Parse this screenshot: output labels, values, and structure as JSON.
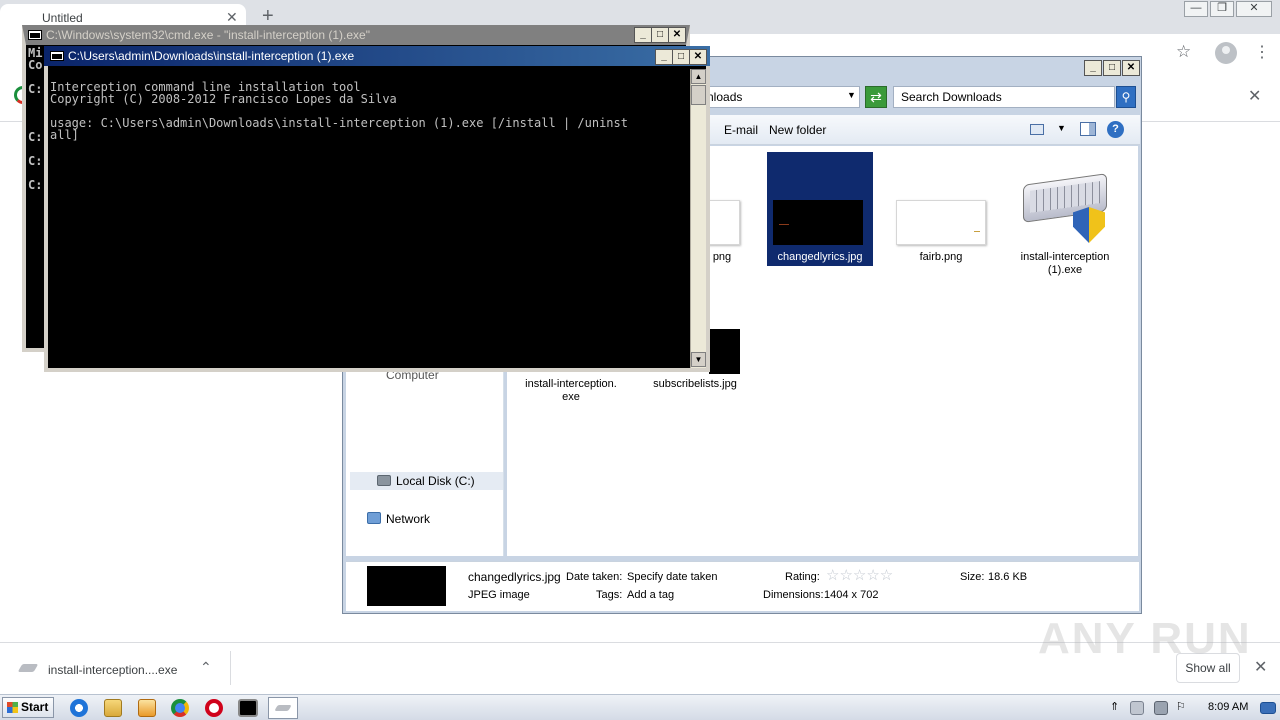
{
  "browser": {
    "tab_title": "Untitled",
    "tab_close": "✕",
    "new_tab": "+",
    "window_controls": [
      "—",
      "❐",
      "✕"
    ],
    "bookmark_icon": "star-icon",
    "menu_glyph": "⋮",
    "infobar_close": "✕"
  },
  "downloads_shelf": {
    "item_name": "install-interception....exe",
    "item_chevron": "⌃",
    "show_all": "Show all",
    "close": "✕"
  },
  "watermark": "ANY RUN",
  "explorer": {
    "address_text": "nloads",
    "search_placeholder": "Search Downloads",
    "commands": [
      "E-mail",
      "New folder"
    ],
    "nav": {
      "computer": "Computer",
      "local_disk": "Local Disk (C:)",
      "network": "Network"
    },
    "files": [
      {
        "name": "png",
        "type": "image-white"
      },
      {
        "name": "changedlyrics.jpg",
        "type": "image-black",
        "selected": true
      },
      {
        "name": "fairb.png",
        "type": "image-white"
      },
      {
        "name": "install-interception (1).exe",
        "type": "exe"
      },
      {
        "name": "install-interception.\nexe",
        "type": "exe"
      },
      {
        "name": "subscribelists.jpg",
        "type": "image-black"
      }
    ],
    "details": {
      "file_name": "changedlyrics.jpg",
      "file_type": "JPEG image",
      "date_taken_label": "Date taken:",
      "date_taken_value": "Specify date taken",
      "tags_label": "Tags:",
      "tags_value": "Add a tag",
      "rating_label": "Rating:",
      "rating_stars": "☆☆☆☆☆",
      "dimensions_label": "Dimensions:",
      "dimensions_value": "1404 x 702",
      "size_label": "Size:",
      "size_value": "18.6 KB"
    }
  },
  "cmd_back": {
    "title": "C:\\Windows\\system32\\cmd.exe - \"install-interception (1).exe\"",
    "left_glyphs": [
      "Mi",
      "Co",
      "C:",
      "C:",
      "C:",
      "C:"
    ]
  },
  "cmd_front": {
    "title": "C:\\Users\\admin\\Downloads\\install-interception (1).exe",
    "line1": "Interception command line installation tool",
    "line2": "Copyright (C) 2008-2012 Francisco Lopes da Silva",
    "line3": "usage: C:\\Users\\admin\\Downloads\\install-interception (1).exe [/install | /uninst",
    "line4": "all]"
  },
  "taskbar": {
    "start": "Start",
    "clock": "8:09 AM",
    "icons": [
      "ie-icon",
      "explorer-icon",
      "media-player-icon",
      "chrome-icon",
      "opera-icon",
      "cmd-icon",
      "interception-icon"
    ]
  },
  "colors": {
    "cmd_title_active": "#0a246a",
    "selection": "#0f2a6e",
    "chrome_tabbar": "#dee1e6"
  }
}
